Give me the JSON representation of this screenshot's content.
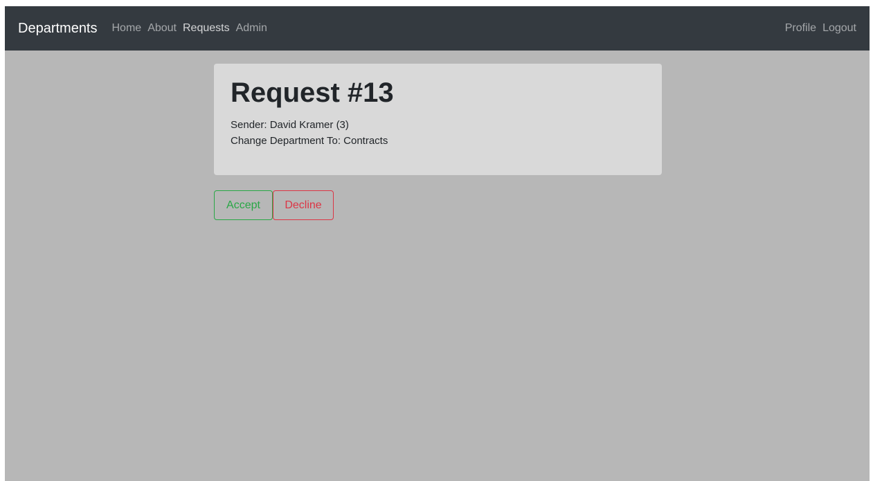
{
  "navbar": {
    "brand": "Departments",
    "links": [
      "Home",
      "About",
      "Requests",
      "Admin"
    ],
    "right_links": [
      "Profile",
      "Logout"
    ]
  },
  "request": {
    "title": "Request #13",
    "sender": "Sender: David Kramer (3)",
    "change": "Change Department To: Contracts"
  },
  "actions": {
    "accept": "Accept",
    "decline": "Decline"
  },
  "colors": {
    "navbar_bg": "#343a40",
    "page_bg": "#b7b7b7",
    "card_bg": "#d9d9d9",
    "accept": "#28a745",
    "decline": "#dc3545"
  }
}
